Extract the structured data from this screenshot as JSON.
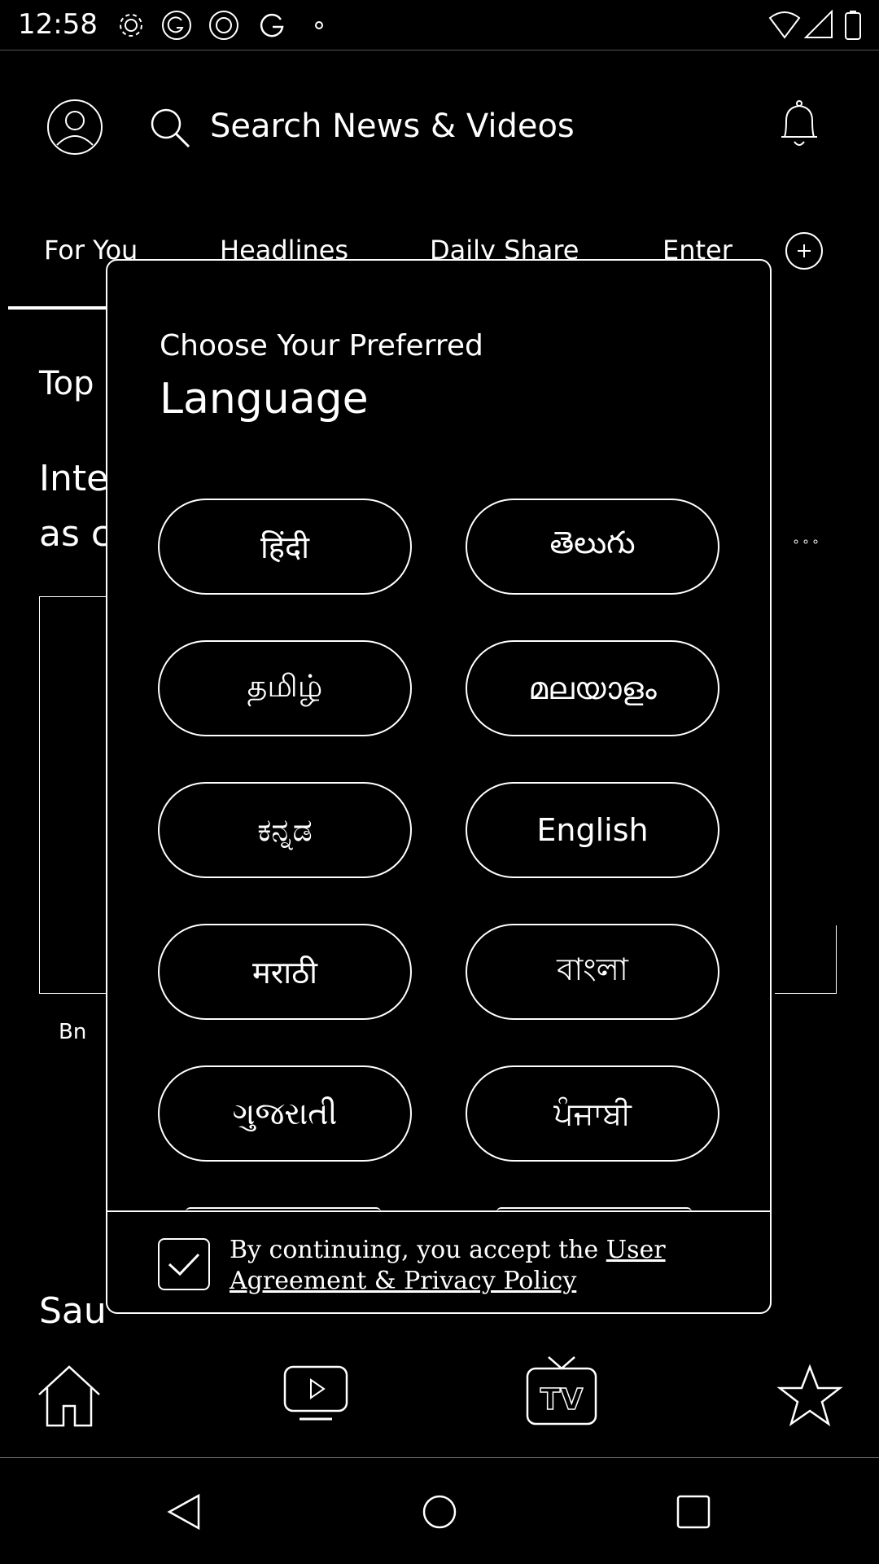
{
  "status_bar": {
    "time": "12:58",
    "icons": [
      "gear-icon",
      "g-circle-icon",
      "loop-icon",
      "google-icon",
      "dot-icon",
      "wifi-icon",
      "signal-icon",
      "battery-icon"
    ]
  },
  "header": {
    "search_placeholder": "Search News & Videos",
    "icons": [
      "profile-icon",
      "search-icon",
      "bell-icon"
    ]
  },
  "tabs": [
    {
      "label": "For You"
    },
    {
      "label": "Headlines"
    },
    {
      "label": "Daily Share"
    },
    {
      "label": "Enter"
    }
  ],
  "feed": {
    "section_label": "Top",
    "headline_line1": "Inte",
    "headline_line2": "as c",
    "source_label": "Bn",
    "bottom_headline": "Sau"
  },
  "modal": {
    "title_line1": "Choose Your Preferred",
    "title_line2": "Language",
    "languages": [
      {
        "label": "हिंदी"
      },
      {
        "label": "తెలుగు"
      },
      {
        "label": "தமிழ்"
      },
      {
        "label": "മലയാളം"
      },
      {
        "label": "ಕನ್ನಡ"
      },
      {
        "label": "English"
      },
      {
        "label": "मराठी"
      },
      {
        "label": "বাংলা"
      },
      {
        "label": "ગુજરાતી"
      },
      {
        "label": "ਪੰਜਾਬੀ"
      }
    ],
    "consent_prefix": "By continuing, you accept the ",
    "consent_link": "User Agreement & Privacy Policy",
    "consent_checked": true
  },
  "bottom_nav": {
    "icons": [
      "home-icon",
      "video-icon",
      "tv-icon",
      "star-icon"
    ]
  },
  "system_nav": {
    "icons": [
      "back-icon",
      "home-circle-icon",
      "recents-icon"
    ]
  },
  "colors": {
    "background": "#000000",
    "foreground": "#ffffff"
  }
}
